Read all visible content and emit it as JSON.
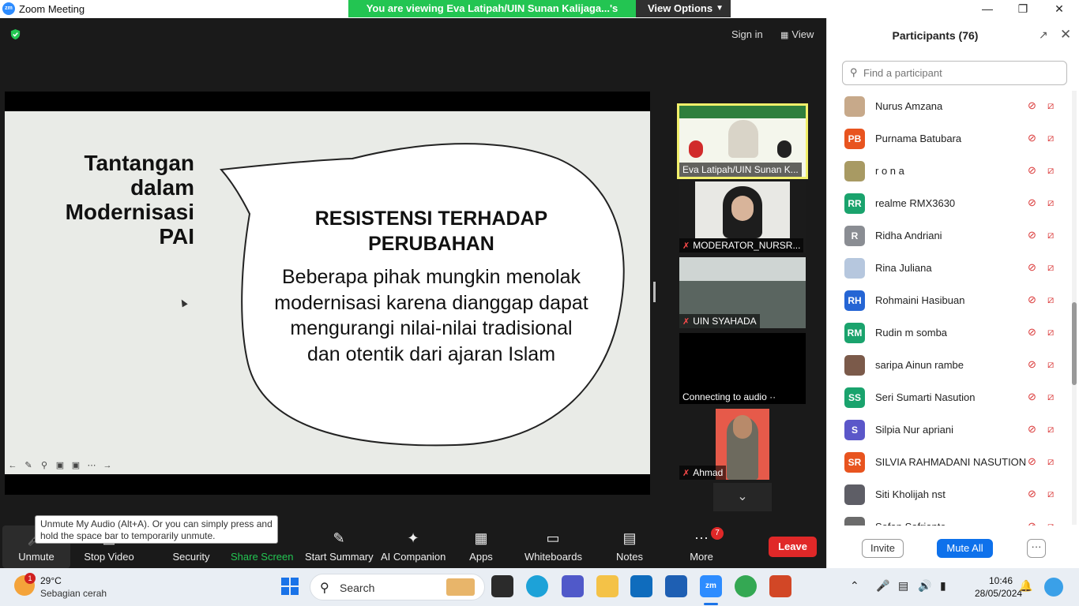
{
  "window": {
    "app_logo": "zm",
    "title": "Zoom Meeting",
    "share_banner": "You are viewing Eva Latipah/UIN Sunan Kalijaga...'s screen",
    "view_options": "View Options",
    "minimize_icon": "minimize-icon",
    "maximize_icon": "maximize-icon",
    "close_icon": "close-icon"
  },
  "meeting": {
    "sign_in": "Sign in",
    "view": "View"
  },
  "slide": {
    "title": "Tantangan dalam Modernisasi PAI",
    "heading": "RESISTENSI TERHADAP PERUBAHAN",
    "body": "Beberapa pihak mungkin menolak modernisasi karena dianggap dapat mengurangi nilai-nilai tradisional dan otentik dari ajaran Islam"
  },
  "video_tiles": [
    {
      "name": "Eva Latipah/UIN Sunan K...",
      "muted": false,
      "active_speaker": true
    },
    {
      "name": "MODERATOR_NURSR...",
      "muted": true
    },
    {
      "name": "UIN SYAHADA",
      "muted": true
    },
    {
      "name": "Connecting to audio ··",
      "muted": false
    },
    {
      "name": "Ahmad",
      "muted": true
    }
  ],
  "toolbar": {
    "unmute": "Unmute",
    "stop_video": "Stop Video",
    "security": "Security",
    "share_screen": "Share Screen",
    "start_summary": "Start Summary",
    "ai_companion": "AI Companion",
    "apps": "Apps",
    "whiteboards": "Whiteboards",
    "notes": "Notes",
    "more": "More",
    "more_badge": "7",
    "leave": "Leave",
    "tooltip": "Unmute My Audio (Alt+A). Or you can simply press and hold the space bar to temporarily unmute."
  },
  "participants": {
    "title": "Participants (76)",
    "search_placeholder": "Find a participant",
    "list": [
      {
        "name": "Nurus Amzana",
        "initials": "",
        "color": "#c7a98a"
      },
      {
        "name": "Purnama Batubara",
        "initials": "PB",
        "color": "#e8541f"
      },
      {
        "name": "r o n a",
        "initials": "",
        "color": "#a89a63"
      },
      {
        "name": "realme RMX3630",
        "initials": "RR",
        "color": "#1aa36d"
      },
      {
        "name": "Ridha Andriani",
        "initials": "R",
        "color": "#8a8d93"
      },
      {
        "name": "Rina Juliana",
        "initials": "",
        "color": "#b6c7de"
      },
      {
        "name": "Rohmaini Hasibuan",
        "initials": "RH",
        "color": "#2565d4"
      },
      {
        "name": "Rudin m somba",
        "initials": "RM",
        "color": "#1aa36d"
      },
      {
        "name": "saripa Ainun rambe",
        "initials": "",
        "color": "#7b5a4a"
      },
      {
        "name": "Seri Sumarti Nasution",
        "initials": "SS",
        "color": "#1aa36d"
      },
      {
        "name": "Silpia Nur apriani",
        "initials": "S",
        "color": "#5b57c9"
      },
      {
        "name": "SILVIA RAHMADANI NASUTION",
        "initials": "SR",
        "color": "#e8541f"
      },
      {
        "name": "Siti Kholijah nst",
        "initials": "",
        "color": "#5e5e66"
      },
      {
        "name": "Sofan Safrianto",
        "initials": "",
        "color": "#6b6b6b"
      }
    ],
    "invite": "Invite",
    "mute_all": "Mute All",
    "more": "···"
  },
  "taskbar": {
    "weather_badge": "1",
    "temperature": "29°C",
    "weather": "Sebagian cerah",
    "search": "Search",
    "time": "10:46",
    "date": "28/05/2024"
  }
}
